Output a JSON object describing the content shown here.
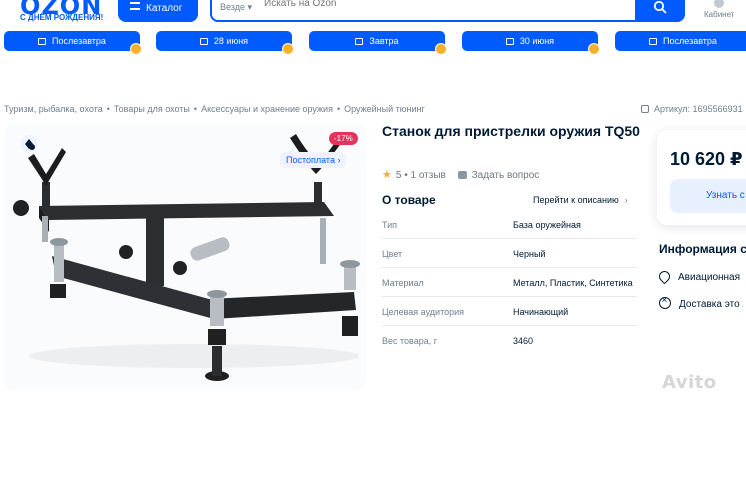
{
  "header": {
    "logo": "OZON",
    "logo_sub": "С ДНЁМ РОЖДЕНИЯ!",
    "catalog_label": "Каталог",
    "search_scope": "Везде ▾",
    "search_placeholder": "Искать на Ozon",
    "cabinet_label": "Кабинет"
  },
  "delivery_chips": [
    {
      "label": "Послезавтра"
    },
    {
      "label": "28 июня"
    },
    {
      "label": "Завтра"
    },
    {
      "label": "30 июня"
    },
    {
      "label": "Послезавтра"
    }
  ],
  "breadcrumb": [
    "Туризм, рыбалка, охота",
    "Товары для охоты",
    "Аксессуары и хранение оружия",
    "Оружейный тюнинг"
  ],
  "article": "Артикул: 1695566931",
  "product": {
    "title": "Станок для пристрелки оружия TQ50",
    "discount": "-17%",
    "postoplata": "Постоплата ›",
    "rating": "5",
    "reviews": "1 отзыв",
    "ask": "Задать вопрос"
  },
  "about": {
    "title": "О товаре",
    "to_description": "Перейти к описанию",
    "specs": [
      {
        "key": "Тип",
        "value": "База оружейная"
      },
      {
        "key": "Цвет",
        "value": "Черный"
      },
      {
        "key": "Материал",
        "value": "Металл, Пластик, Синтетика"
      },
      {
        "key": "Целевая аудитория",
        "value": "Начинающий"
      },
      {
        "key": "Вес товара, г",
        "value": "3460"
      }
    ]
  },
  "buy": {
    "price": "10 620 ₽",
    "know_button": "Узнать с"
  },
  "info": {
    "title": "Информация с",
    "rows": [
      "Авиационная",
      "Доставка это"
    ]
  },
  "watermark": "Avito",
  "colors": {
    "accent": "#005bff",
    "discount": "#e5335f",
    "coin": "#f6b12b"
  }
}
